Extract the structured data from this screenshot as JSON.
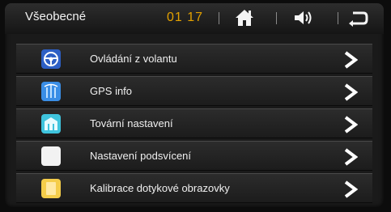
{
  "header": {
    "title": "Všeobecné",
    "time": "01 17",
    "icons": [
      "home-icon",
      "volume-icon",
      "back-icon"
    ],
    "accent_color": "#e3a100"
  },
  "menu": {
    "items": [
      {
        "label": "Ovládání z volantu",
        "icon": "steering-wheel-icon",
        "icon_color": "#2d5fc4"
      },
      {
        "label": "GPS info",
        "icon": "gps-icon",
        "icon_color": "#3a8ee6"
      },
      {
        "label": "Tovární nastavení",
        "icon": "factory-icon",
        "icon_color": "#3fc4dd"
      },
      {
        "label": "Nastavení podsvícení",
        "icon": "backlight-icon",
        "icon_color": "#f2f2f2"
      },
      {
        "label": "Kalibrace dotykové obrazovky",
        "icon": "touch-calibration-icon",
        "icon_color": "#f5cd4a"
      }
    ]
  }
}
